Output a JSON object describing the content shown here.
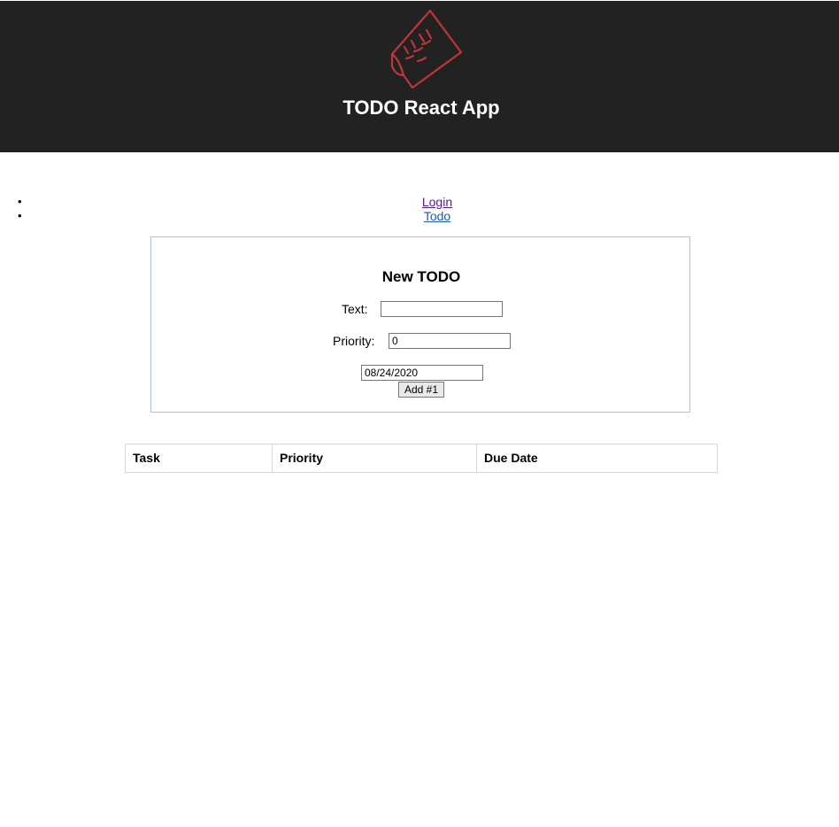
{
  "header": {
    "title": "TODO React App",
    "logo_icon": "todo-list-paper-icon",
    "logo_color": "#c1353a",
    "background": "#222222"
  },
  "nav": {
    "items": [
      {
        "label": "Login",
        "color": "#551a8b"
      },
      {
        "label": "Todo",
        "color": "#1a5ab8"
      }
    ]
  },
  "form": {
    "title": "New TODO",
    "text_label": "Text:",
    "text_value": "",
    "priority_label": "Priority:",
    "priority_value": "0",
    "date_value": "08/24/2020",
    "add_button_label": "Add #1",
    "border_color": "#a9c3d8"
  },
  "table": {
    "columns": [
      "Task",
      "Priority",
      "Due Date"
    ],
    "rows": []
  }
}
